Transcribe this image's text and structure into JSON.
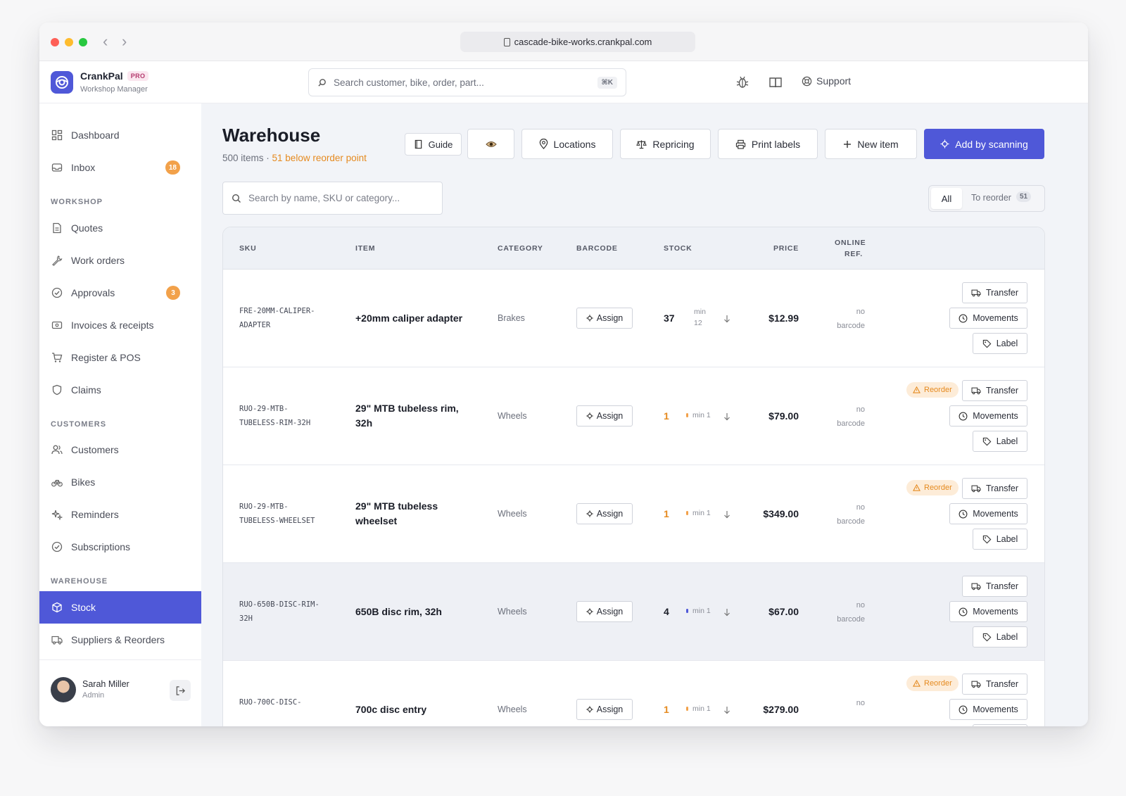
{
  "browser": {
    "url": "cascade-bike-works.crankpal.com"
  },
  "brand": {
    "name": "CrankPal",
    "badge": "PRO",
    "subtitle": "Workshop Manager"
  },
  "header": {
    "search_placeholder": "Search customer, bike, order, part...",
    "shortcut": "⌘K",
    "support_label": "Support"
  },
  "sidebar": {
    "dashboard": "Dashboard",
    "inbox": "Inbox",
    "inbox_badge": "18",
    "section_workshop": "WORKSHOP",
    "quotes": "Quotes",
    "work_orders": "Work orders",
    "approvals": "Approvals",
    "approvals_badge": "3",
    "invoices": "Invoices & receipts",
    "register": "Register & POS",
    "claims": "Claims",
    "section_customers": "CUSTOMERS",
    "customers": "Customers",
    "bikes": "Bikes",
    "reminders": "Reminders",
    "subscriptions": "Subscriptions",
    "section_warehouse": "WAREHOUSE",
    "stock": "Stock",
    "suppliers": "Suppliers & Reorders"
  },
  "user": {
    "name": "Sarah Miller",
    "role": "Admin"
  },
  "page": {
    "title": "Warehouse",
    "count": "500 items",
    "separator": " · ",
    "below": "51 below reorder point",
    "buttons": {
      "guide": "Guide",
      "locations": "Locations",
      "repricing": "Repricing",
      "print_labels": "Print labels",
      "new_item": "New item",
      "add_by_scanning": "Add by scanning"
    },
    "search_placeholder": "Search by name, SKU or category...",
    "filter": {
      "all": "All",
      "to_reorder": "To reorder",
      "to_reorder_count": "51"
    }
  },
  "table": {
    "headers": {
      "sku": "SKU",
      "item": "ITEM",
      "category": "CATEGORY",
      "barcode": "BARCODE",
      "stock": "STOCK",
      "price": "PRICE",
      "online_ref_1": "ONLINE",
      "online_ref_2": "REF."
    },
    "assign_label": "Assign",
    "actions": {
      "transfer": "Transfer",
      "movements": "Movements",
      "label": "Label",
      "reorder": "Reorder"
    },
    "rows": [
      {
        "sku1": "FRE-20MM-CALIPER-",
        "sku2": "ADAPTER",
        "item1": "+20mm caliper adapter",
        "item2": "",
        "category": "Brakes",
        "stock": "37",
        "min1": "min",
        "min2": "12",
        "price": "$12.99",
        "ref1": "no",
        "ref2": "barcode",
        "reorder": false
      },
      {
        "sku1": "RUO-29-MTB-",
        "sku2": "TUBELESS-RIM-32H",
        "item1": "29\" MTB tubeless rim,",
        "item2": "32h",
        "category": "Wheels",
        "stock": "1",
        "min1": "min 1",
        "min2": "",
        "price": "$79.00",
        "ref1": "no",
        "ref2": "barcode",
        "reorder": true
      },
      {
        "sku1": "RUO-29-MTB-",
        "sku2": "TUBELESS-WHEELSET",
        "item1": "29\" MTB tubeless",
        "item2": "wheelset",
        "category": "Wheels",
        "stock": "1",
        "min1": "min 1",
        "min2": "",
        "price": "$349.00",
        "ref1": "no",
        "ref2": "barcode",
        "reorder": true
      },
      {
        "sku1": "RUO-650B-DISC-RIM-",
        "sku2": "32H",
        "item1": "650B disc rim, 32h",
        "item2": "",
        "category": "Wheels",
        "stock": "4",
        "min1": "min 1",
        "min2": "",
        "price": "$67.00",
        "ref1": "no",
        "ref2": "barcode",
        "reorder": false
      },
      {
        "sku1": "RUO-700C-DISC-",
        "sku2": "",
        "item1": "700c disc entry",
        "item2": "",
        "category": "Wheels",
        "stock": "1",
        "min1": "min 1",
        "min2": "",
        "price": "$279.00",
        "ref1": "no",
        "ref2": "",
        "reorder": true
      }
    ]
  },
  "colors": {
    "accent": "#4f58d8",
    "warning": "#e58a1f",
    "badge": "#f2a14a"
  }
}
